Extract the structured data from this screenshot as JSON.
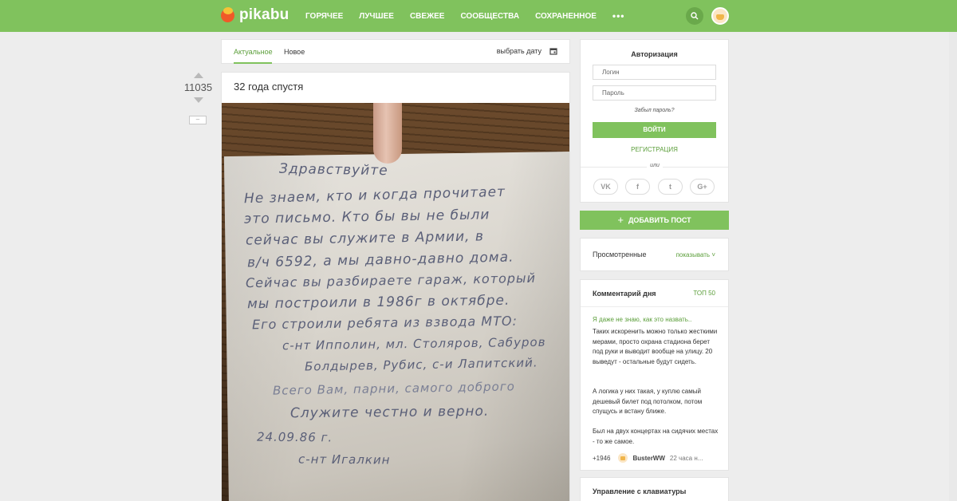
{
  "header": {
    "logo_text": "pikabu",
    "nav": [
      "ГОРЯЧЕЕ",
      "ЛУЧШЕЕ",
      "СВЕЖЕЕ",
      "СООБЩЕСТВА",
      "СОХРАНЕННОЕ"
    ],
    "more": "•••",
    "search_icon": "search-icon",
    "avatar_icon": "user-avatar",
    "accent_color": "#80c25d"
  },
  "tabs": {
    "items": [
      "Актуальное",
      "Новое"
    ],
    "active": "Актуальное",
    "date_label": "выбрать дату",
    "date_icon": "calendar-icon"
  },
  "post": {
    "rating": "11035",
    "collapse_label": "–",
    "title": "32 года спустя",
    "letter_lines": [
      "Здравствуйте",
      "Не знаем, кто и когда прочитает",
      "это письмо. Кто бы вы не были",
      "сейчас вы служите в Армии, в",
      "в/ч 6592, а мы давно-давно дома.",
      "Сейчас вы разбираете гараж, который",
      "мы построили в 1986г в октябре.",
      "Его строили ребята из взвода МТО:",
      "с-нт Ипполин, мл. Столяров, Сабуров",
      "Болдырев, Рубис, с-и Лапитский.",
      "Всего Вам, парни, самого доброго",
      "Служите честно и верно.",
      "24.09.86 г.",
      "с-нт        Игалкин"
    ]
  },
  "auth": {
    "title": "Авторизация",
    "login_placeholder": "Логин",
    "password_placeholder": "Пароль",
    "forgot": "Забыл пароль?",
    "login_button": "ВОЙТИ",
    "register": "РЕГИСТРАЦИЯ",
    "or": "или",
    "socials": [
      {
        "icon": "vk-icon",
        "glyph": "VK"
      },
      {
        "icon": "facebook-icon",
        "glyph": "f"
      },
      {
        "icon": "twitter-icon",
        "glyph": "t"
      },
      {
        "icon": "google-plus-icon",
        "glyph": "G+"
      }
    ]
  },
  "add_post": {
    "plus": "+",
    "label": "ДОБАВИТЬ ПОСТ"
  },
  "viewed": {
    "label": "Просмотренные",
    "show": "показывать ˅"
  },
  "comment_of_day": {
    "title": "Комментарий дня",
    "top": "ТОП 50",
    "post_link": "Я даже не знаю, как это назвать..",
    "paragraphs": [
      "Таких искоренить можно только жесткими мерами, просто охрана стадиона берет под руки и выводит вообще на улицу. 20 выведут - остальные будут сидеть.",
      "А логика у них такая, у куплю самый дешевый билет под потолком, потом спущусь и встану ближе.",
      "Был на двух концертах на сидячих местах - то же самое."
    ],
    "rating": "+1946",
    "user": "BusterWW",
    "time": "22 часа н..."
  },
  "keyboard": {
    "title": "Управление с клавиатуры"
  }
}
